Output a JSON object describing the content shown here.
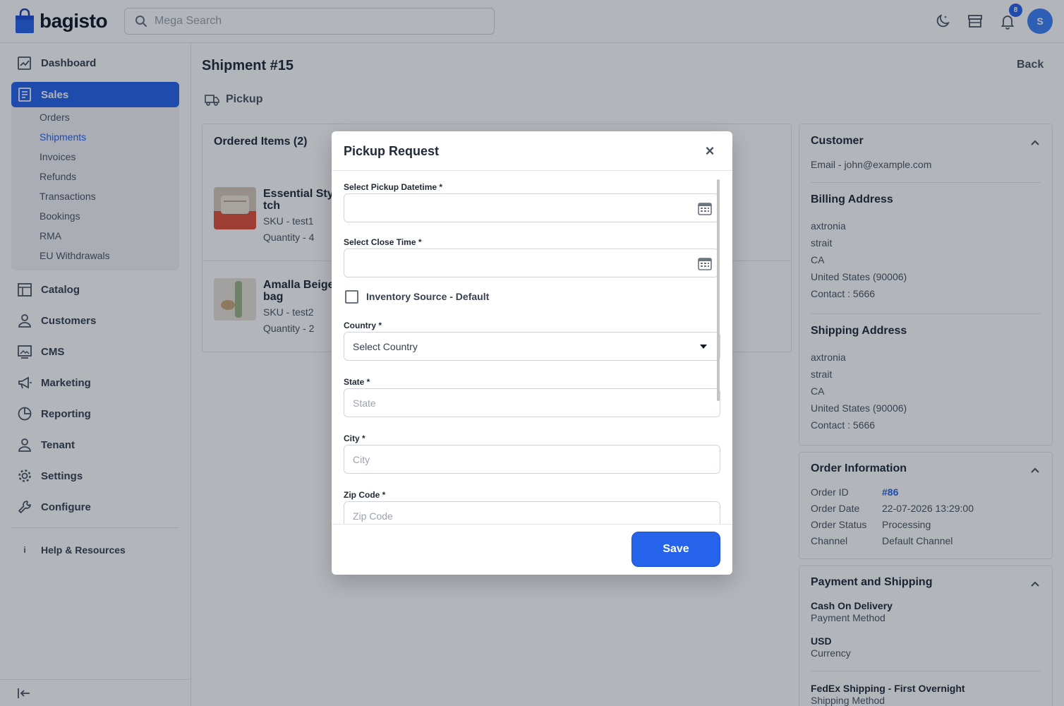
{
  "header": {
    "logo_text": "bagisto",
    "search_placeholder": "Mega Search",
    "notification_count": "8",
    "avatar_initial": "S"
  },
  "sidebar": {
    "items": [
      {
        "label": "Dashboard",
        "icon": "dashboard-icon"
      },
      {
        "label": "Sales",
        "icon": "sales-icon",
        "active": true
      },
      {
        "label": "Catalog",
        "icon": "catalog-icon"
      },
      {
        "label": "Customers",
        "icon": "customers-icon"
      },
      {
        "label": "CMS",
        "icon": "cms-icon"
      },
      {
        "label": "Marketing",
        "icon": "marketing-icon"
      },
      {
        "label": "Reporting",
        "icon": "reporting-icon"
      },
      {
        "label": "Tenant",
        "icon": "tenant-icon"
      },
      {
        "label": "Settings",
        "icon": "settings-icon"
      },
      {
        "label": "Configure",
        "icon": "configure-icon"
      }
    ],
    "sales_submenu": [
      "Orders",
      "Shipments",
      "Invoices",
      "Refunds",
      "Transactions",
      "Bookings",
      "RMA",
      "EU Withdrawals"
    ],
    "help_label": "Help & Resources",
    "help_glyph": "i"
  },
  "page": {
    "title": "Shipment #15",
    "back_label": "Back",
    "pickup_label": "Pickup"
  },
  "ordered_items": {
    "title": "Ordered Items (2)",
    "items": [
      {
        "name_line1": "Essential Sty",
        "name_line2": "tch",
        "sku": "SKU - test1",
        "quantity": "Quantity - 4"
      },
      {
        "name_line1": "Amalla Beige",
        "name_line2": "bag",
        "sku": "SKU - test2",
        "quantity": "Quantity - 2"
      }
    ]
  },
  "customer": {
    "title": "Customer",
    "email": "Email - john@example.com",
    "billing_title": "Billing Address",
    "billing": [
      "axtronia",
      "strait",
      "CA",
      "United States (90006)",
      "Contact : 5666"
    ],
    "shipping_title": "Shipping Address",
    "shipping": [
      "axtronia",
      "strait",
      "CA",
      "United States (90006)",
      "Contact : 5666"
    ]
  },
  "order_info": {
    "title": "Order Information",
    "rows": [
      {
        "label": "Order ID",
        "value": "#86"
      },
      {
        "label": "Order Date",
        "value": "22-07-2026 13:29:00"
      },
      {
        "label": "Order Status",
        "value": "Processing"
      },
      {
        "label": "Channel",
        "value": "Default Channel"
      }
    ]
  },
  "payment_shipping": {
    "title": "Payment and Shipping",
    "payment_value": "Cash On Delivery",
    "payment_label": "Payment Method",
    "currency_value": "USD",
    "currency_label": "Currency",
    "shipping_value": "FedEx Shipping - First Overnight",
    "shipping_label": "Shipping Method"
  },
  "modal": {
    "title": "Pickup Request",
    "close_glyph": "×",
    "pickup_datetime_label": "Select Pickup Datetime *",
    "pickup_datetime_value": "",
    "close_time_label": "Select Close Time *",
    "close_time_value": "",
    "inventory_source_label": "Inventory Source - Default",
    "inventory_source_checked": false,
    "country_label": "Country *",
    "country_value": "Select Country",
    "state_label": "State *",
    "state_placeholder": "State",
    "city_label": "City *",
    "city_placeholder": "City",
    "zip_label": "Zip Code *",
    "zip_placeholder": "Zip Code",
    "save_label": "Save"
  },
  "colors": {
    "accent": "#2563eb",
    "overlay": "#111827"
  }
}
